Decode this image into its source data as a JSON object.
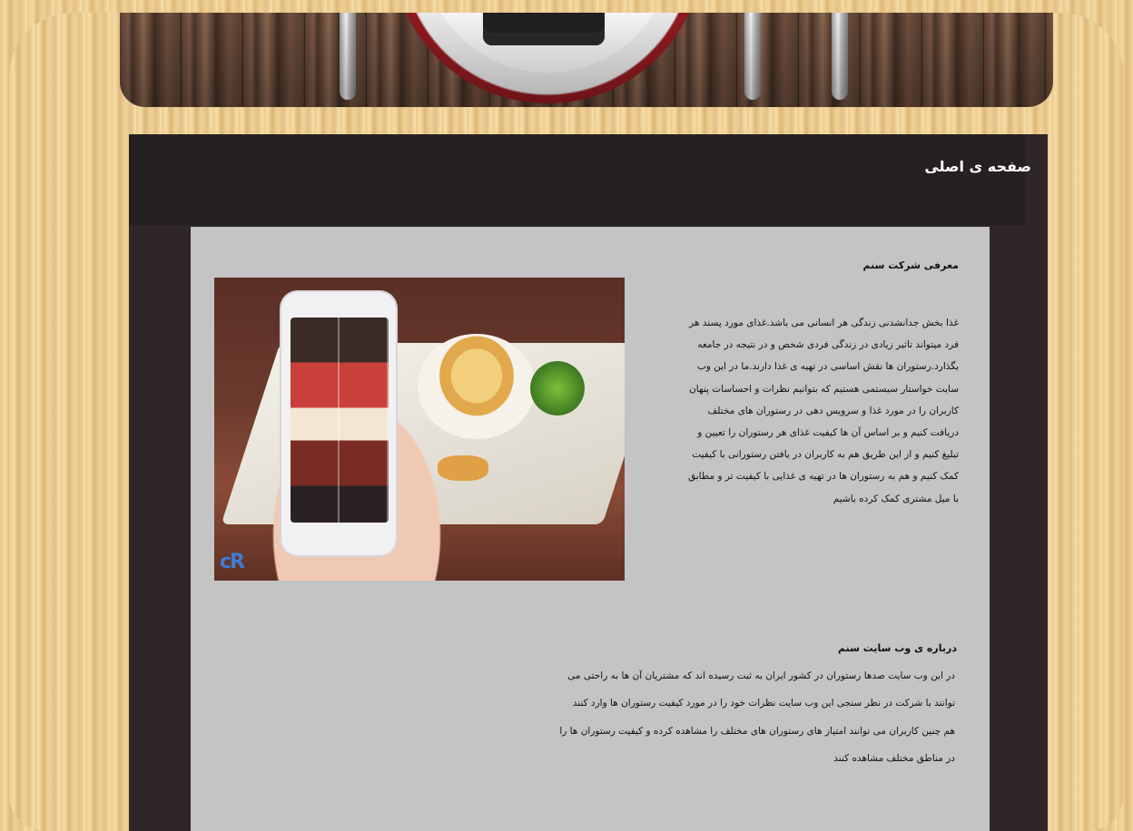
{
  "header": {
    "title": "صفحه ی اصلی"
  },
  "intro": {
    "heading": "معرفی شرکت سنم",
    "body": "غذا بخش جدانشدنی زندگی هر انسانی می باشد.غذای مورد پسند هر فرد میتواند تاثیر زیادی در زندگی فردی شخص و در نتیجه در جامعه بگذارد.رستوران ها نقش اساسی در تهیه ی غذا دارند.ما در این وب سایت خواستار سیستمی هستیم که بتوانیم نظرات و احساسات پنهان کاربران را در مورد غذا و سرویس دهی در رستوران های مختلف دریافت کنیم و بر اساس آن ها کیفیت  غذای هر رستوران را تعیین و تبلیغ کنیم و از این طریق هم به کاربران در یافتن رستورانی با کیفیت کمک کنیم و هم به رستوران ها در تهیه ی غذایی با کیفیت تر و مطابق با میل مشتری کمک کرده باشیم"
  },
  "photo": {
    "alt": "phone-food-ordering-photo",
    "logo_text": "cR"
  },
  "about": {
    "heading": "درباره ی وب سایت سنم",
    "p1": " در این وب سایت صدها رستوران در کشور ایران به ثبت رسیده اند که مشتریان آن ها به راحتی می توانند با شرکت در نظر سنجی این وب سایت نظرات خود را در مورد کیفیت رستوران ها وارد کنند",
    "p2": "هم چنین کاربران می توانند امتیاز های رستوران های مختلف را مشاهده کرده و کیفیت رستوران ها را در مناطق مختلف مشاهده کنند"
  }
}
